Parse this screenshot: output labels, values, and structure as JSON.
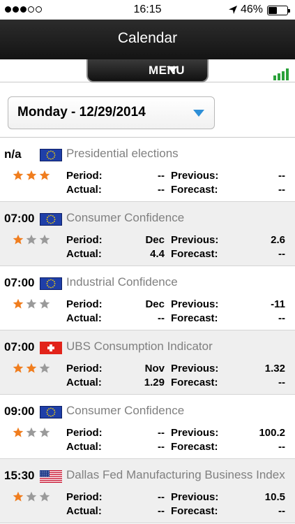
{
  "status_bar": {
    "carrier_dots_filled": 3,
    "carrier_dots_total": 5,
    "time": "16:15",
    "battery_percent": "46%",
    "battery_level": 0.46
  },
  "nav": {
    "title": "Calendar"
  },
  "menu": {
    "label": "MENU"
  },
  "date_selector": {
    "value": "Monday - 12/29/2014"
  },
  "labels": {
    "period": "Period:",
    "actual": "Actual:",
    "previous": "Previous:",
    "forecast": "Forecast:"
  },
  "colors": {
    "star_on": "#f07d1e",
    "star_off": "#9a9a9a",
    "accent": "#2e8fd7",
    "signal_green": "#2aa13a"
  },
  "events": [
    {
      "time": "n/a",
      "flag": "eu-flag-icon",
      "name": "Presidential elections",
      "importance": 3,
      "period": "--",
      "actual": "--",
      "previous": "--",
      "forecast": "--"
    },
    {
      "time": "07:00",
      "flag": "eu-flag-icon",
      "name": "Consumer Confidence",
      "importance": 1,
      "period": "Dec",
      "actual": "4.4",
      "previous": "2.6",
      "forecast": "--"
    },
    {
      "time": "07:00",
      "flag": "eu-flag-icon",
      "name": "Industrial Confidence",
      "importance": 1,
      "period": "Dec",
      "actual": "--",
      "previous": "-11",
      "forecast": "--"
    },
    {
      "time": "07:00",
      "flag": "swiss-flag-icon",
      "name": "UBS Consumption Indicator",
      "importance": 2,
      "period": "Nov",
      "actual": "1.29",
      "previous": "1.32",
      "forecast": "--"
    },
    {
      "time": "09:00",
      "flag": "eu-flag-icon",
      "name": "Consumer Confidence",
      "importance": 1,
      "period": "--",
      "actual": "--",
      "previous": "100.2",
      "forecast": "--"
    },
    {
      "time": "15:30",
      "flag": "us-flag-icon",
      "name": "Dallas Fed Manufacturing Business Index",
      "importance": 1,
      "period": "--",
      "actual": "--",
      "previous": "10.5",
      "forecast": "--"
    }
  ]
}
